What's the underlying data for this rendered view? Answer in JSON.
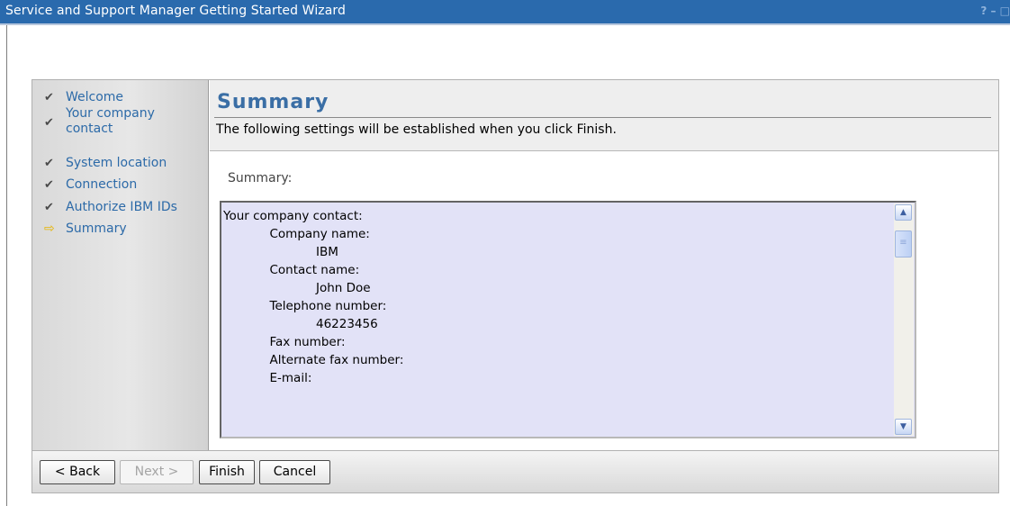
{
  "window": {
    "title": "Service and Support Manager Getting Started Wizard",
    "controls": "? – □"
  },
  "nav": {
    "items": [
      {
        "label": "Welcome",
        "state": "done",
        "icon": "checkmark-icon"
      },
      {
        "label": "Your company contact",
        "state": "done",
        "icon": "checkmark-icon"
      },
      {
        "label": "System location",
        "state": "done",
        "icon": "checkmark-icon"
      },
      {
        "label": "Connection",
        "state": "done",
        "icon": "checkmark-icon"
      },
      {
        "label": "Authorize IBM IDs",
        "state": "done",
        "icon": "checkmark-icon"
      },
      {
        "label": "Summary",
        "state": "current",
        "icon": "arrow-right-icon"
      }
    ]
  },
  "header": {
    "title": "Summary",
    "description": "The following settings will be established when you click Finish."
  },
  "summary": {
    "label": "Summary:",
    "lines": [
      "Your company contact:",
      "",
      "            Company name:",
      "                        IBM",
      "            Contact name:",
      "                        John Doe",
      "            Telephone number:",
      "                        46223456",
      "            Fax number:",
      "",
      "            Alternate fax number:",
      "",
      "            E-mail:"
    ]
  },
  "buttons": {
    "back": "< Back",
    "next": "Next >",
    "finish": "Finish",
    "cancel": "Cancel"
  },
  "colors": {
    "titlebar": "#2a6aad",
    "nav_link": "#2c6aa8",
    "heading": "#3a6ea5",
    "textbox_bg": "#e2e2f7"
  }
}
